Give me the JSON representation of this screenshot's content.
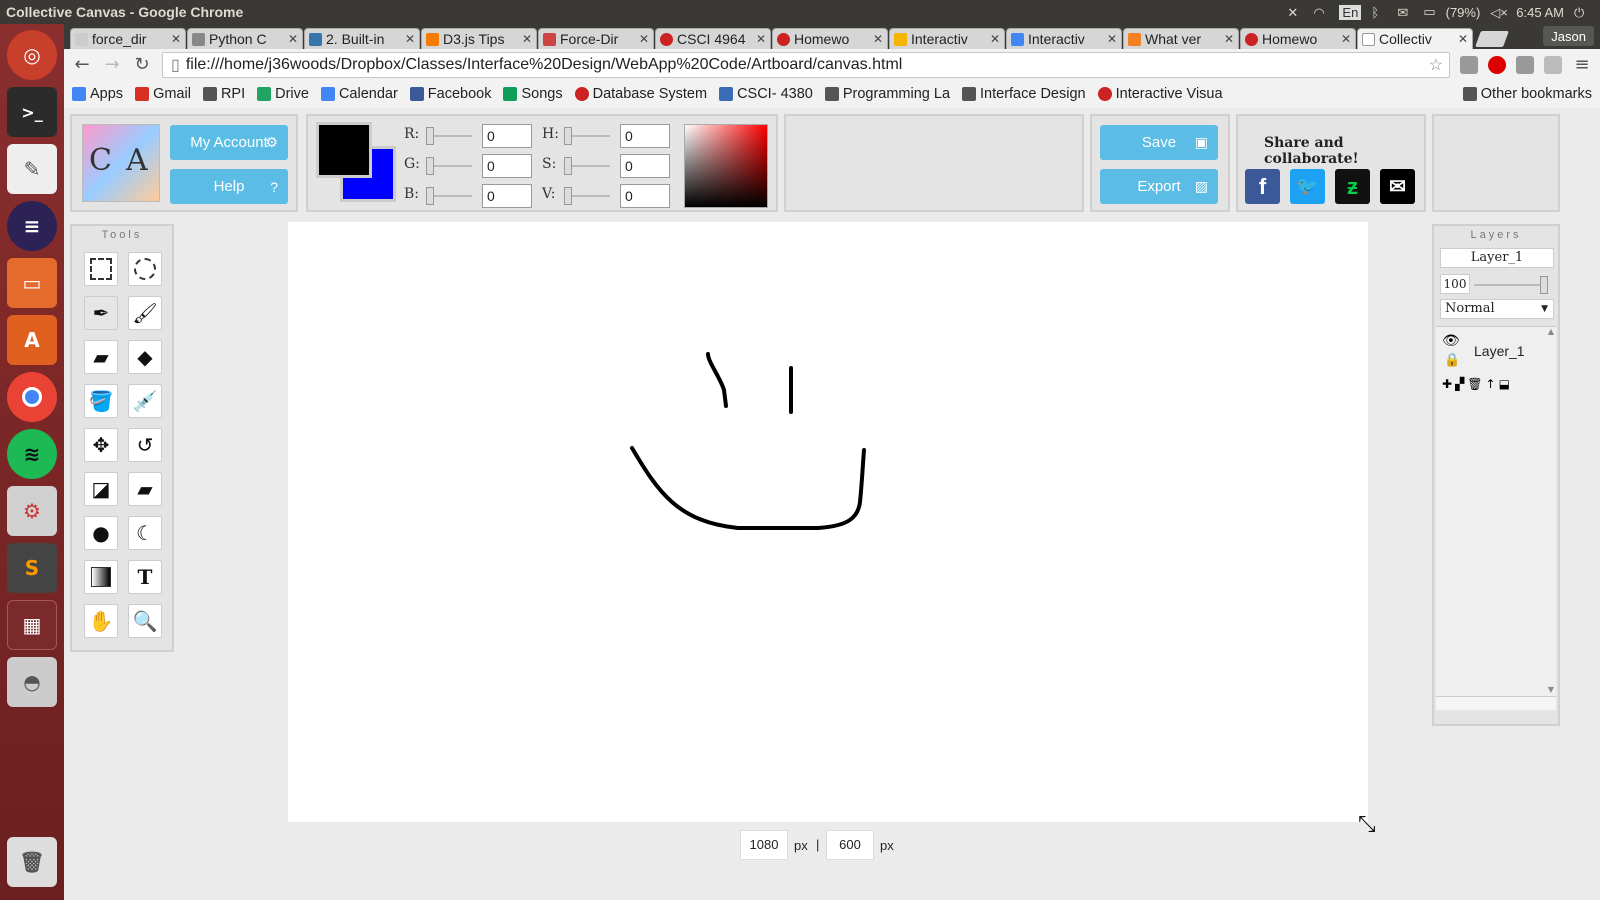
{
  "system": {
    "window_title": "Collective Canvas - Google Chrome",
    "lang": "En",
    "battery": "(79%)",
    "clock": "6:45 AM"
  },
  "browser": {
    "tabs": [
      {
        "label": "force_dir",
        "fav": "#ccc"
      },
      {
        "label": "Python C",
        "fav": "#888"
      },
      {
        "label": "2. Built-in",
        "fav": "#3776ab"
      },
      {
        "label": "D3.js Tips",
        "fav": "#f57c00"
      },
      {
        "label": "Force-Dir",
        "fav": "#c44"
      },
      {
        "label": "CSCI 4964",
        "fav": "#c22"
      },
      {
        "label": "Homewo",
        "fav": "#c22"
      },
      {
        "label": "Interactiv",
        "fav": "#f4b400"
      },
      {
        "label": "Interactiv",
        "fav": "#4285f4"
      },
      {
        "label": "What ver",
        "fav": "#f48024"
      },
      {
        "label": "Homewo",
        "fav": "#c22"
      },
      {
        "label": "Collectiv",
        "fav": "#fff"
      }
    ],
    "user": "Jason",
    "url": "file:///home/j36woods/Dropbox/Classes/Interface%20Design/WebApp%20Code/Artboard/canvas.html",
    "bookmarks": [
      {
        "label": "Apps",
        "color": "#4285f4"
      },
      {
        "label": "Gmail",
        "color": "#d93025"
      },
      {
        "label": "RPI",
        "color": "#555"
      },
      {
        "label": "Drive",
        "color": "#1fa463"
      },
      {
        "label": "Calendar",
        "color": "#4285f4"
      },
      {
        "label": "Facebook",
        "color": "#3b5998"
      },
      {
        "label": "Songs",
        "color": "#0f9d58"
      },
      {
        "label": "Database System",
        "color": "#c22"
      },
      {
        "label": "CSCI- 4380",
        "color": "#3b6cb7"
      },
      {
        "label": "Programming La",
        "color": "#555"
      },
      {
        "label": "Interface Design",
        "color": "#555"
      },
      {
        "label": "Interactive Visua",
        "color": "#c22"
      }
    ],
    "other_bookmarks": "Other bookmarks"
  },
  "app": {
    "logo_text": "CA",
    "my_account": "My Account",
    "help": "Help",
    "color": {
      "R": "0",
      "G": "0",
      "B": "0",
      "H": "0",
      "S": "0",
      "V": "0",
      "primary": "#000000",
      "secondary": "#0000ff",
      "labels": {
        "r": "R:",
        "g": "G:",
        "b": "B:",
        "h": "H:",
        "s": "S:",
        "v": "V:"
      }
    },
    "save": "Save",
    "export": "Export",
    "share_title": "Share and collaborate!",
    "tools_title": "Tools",
    "layers_title": "Layers",
    "layer_name_field": "Layer_1",
    "opacity": "100",
    "blend_mode": "Normal",
    "layers": [
      {
        "name": "Layer_1"
      }
    ],
    "canvas_width": "1080",
    "canvas_height": "600",
    "unit": "px",
    "separator": "|"
  }
}
